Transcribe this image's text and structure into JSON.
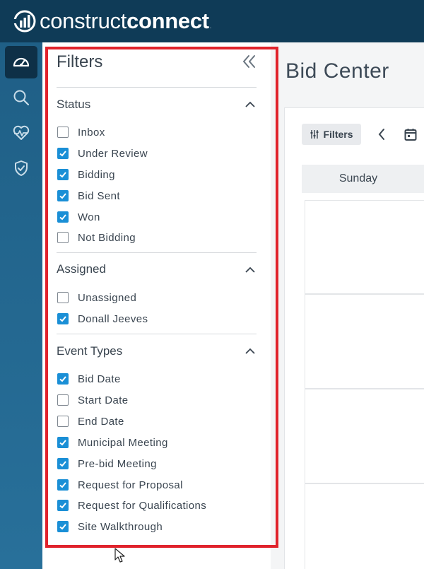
{
  "brand": {
    "light": "construct",
    "bold": "connect",
    "mark": "."
  },
  "colors": {
    "accent": "#1a8fd6",
    "header": "#0f3b57",
    "rail": "#1f5f86",
    "highlight": "#e0232c"
  },
  "rail": {
    "icons": [
      "dashboard-icon",
      "search-icon",
      "health-icon",
      "shield-check-icon"
    ]
  },
  "page": {
    "title": "Bid Center"
  },
  "toolbar": {
    "filters_label": "Filters"
  },
  "calendar": {
    "day_header": "Sunday"
  },
  "filters": {
    "title": "Filters",
    "sections": [
      {
        "title": "Status",
        "options": [
          {
            "label": "Inbox",
            "checked": false
          },
          {
            "label": "Under Review",
            "checked": true
          },
          {
            "label": "Bidding",
            "checked": true
          },
          {
            "label": "Bid Sent",
            "checked": true
          },
          {
            "label": "Won",
            "checked": true
          },
          {
            "label": "Not Bidding",
            "checked": false
          }
        ]
      },
      {
        "title": "Assigned",
        "options": [
          {
            "label": "Unassigned",
            "checked": false
          },
          {
            "label": "Donall Jeeves",
            "checked": true
          }
        ]
      },
      {
        "title": "Event Types",
        "options": [
          {
            "label": "Bid Date",
            "checked": true
          },
          {
            "label": "Start Date",
            "checked": false
          },
          {
            "label": "End Date",
            "checked": false
          },
          {
            "label": "Municipal Meeting",
            "checked": true
          },
          {
            "label": "Pre-bid Meeting",
            "checked": true
          },
          {
            "label": "Request for Proposal",
            "checked": true
          },
          {
            "label": "Request for Qualifications",
            "checked": true
          },
          {
            "label": "Site Walkthrough",
            "checked": true
          }
        ]
      }
    ]
  }
}
